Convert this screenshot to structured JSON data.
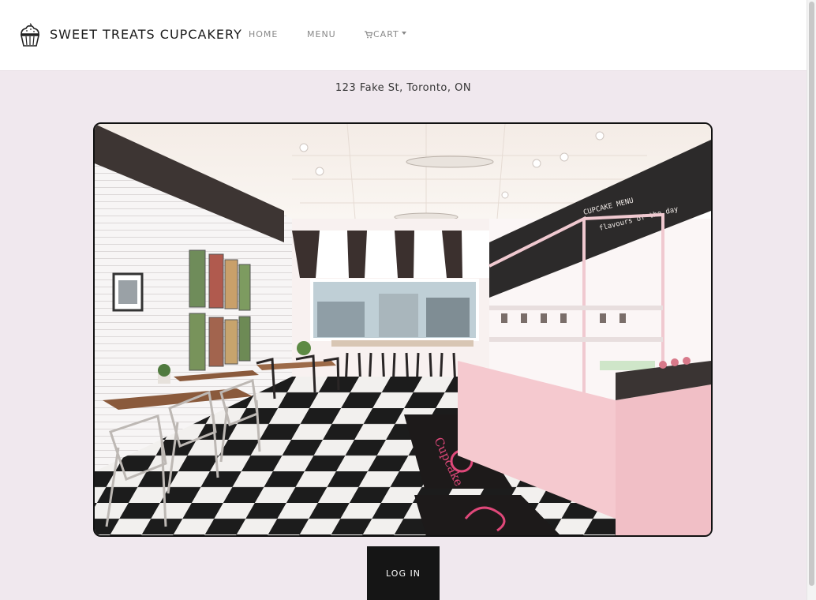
{
  "header": {
    "brand_name": "SWEET TREATS CUPCAKERY",
    "brand_icon": "cupcake-icon",
    "nav": {
      "home": "HOME",
      "menu": "MENU",
      "cart": "CART",
      "cart_icon": "cart-icon",
      "cart_dropdown_icon": "caret-down-icon"
    }
  },
  "main": {
    "address": "123 Fake St, Toronto, ON",
    "photo_subject": "cupcake shop interior",
    "login_label": "LOG IN"
  },
  "colors": {
    "page_background": "#f0e8ee",
    "header_background": "#ffffff",
    "button_background": "#151515",
    "button_text": "#ffffff",
    "nav_text": "#888888"
  }
}
